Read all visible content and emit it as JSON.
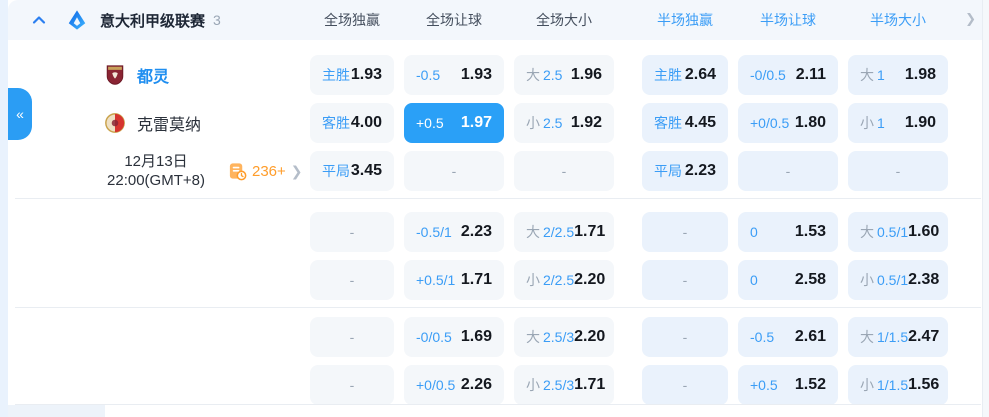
{
  "header": {
    "league_title": "意大利甲级联赛",
    "league_count": "3",
    "columns": [
      "全场独赢",
      "全场让球",
      "全场大小",
      "半场独赢",
      "半场让球",
      "半场大小"
    ],
    "more_arrow": "❯"
  },
  "side_toggle_label": "«",
  "match": {
    "home_team": "都灵",
    "away_team": "克雷莫纳",
    "date_line1": "12月13日",
    "date_line2": "22:00(GMT+8)",
    "markets_count": "236+",
    "markets_arrow": "❯"
  },
  "colors": {
    "accent_blue": "#2aa0f7",
    "label_blue": "#3b9df6",
    "orange": "#ff9d2b",
    "header_half_blue": "#3b9df6"
  },
  "odds": {
    "groups": [
      {
        "rows": [
          [
            {
              "lab": "主胜",
              "odd": "1.93"
            },
            {
              "lab": "-0.5",
              "odd": "1.93"
            },
            {
              "pre": "大",
              "lab": "2.5",
              "odd": "1.96"
            },
            {
              "lab": "主胜",
              "odd": "2.64"
            },
            {
              "lab": "-0/0.5",
              "odd": "2.11"
            },
            {
              "pre": "大",
              "lab": "1",
              "odd": "1.98"
            }
          ],
          [
            {
              "lab": "客胜",
              "odd": "4.00"
            },
            {
              "lab": "+0.5",
              "odd": "1.97",
              "sel": true
            },
            {
              "pre": "小",
              "lab": "2.5",
              "odd": "1.92"
            },
            {
              "lab": "客胜",
              "odd": "4.45"
            },
            {
              "lab": "+0/0.5",
              "odd": "1.80"
            },
            {
              "pre": "小",
              "lab": "1",
              "odd": "1.90"
            }
          ],
          [
            {
              "lab": "平局",
              "odd": "3.45"
            },
            {
              "dash": "-"
            },
            {
              "dash": "-"
            },
            {
              "lab": "平局",
              "odd": "2.23"
            },
            {
              "dash": "-"
            },
            {
              "dash": "-"
            }
          ]
        ]
      },
      {
        "rows": [
          [
            {
              "dash": "-"
            },
            {
              "lab": "-0.5/1",
              "odd": "2.23"
            },
            {
              "pre": "大",
              "lab": "2/2.5",
              "odd": "1.71"
            },
            {
              "dash": "-"
            },
            {
              "lab": "0",
              "odd": "1.53"
            },
            {
              "pre": "大",
              "lab": "0.5/1",
              "odd": "1.60"
            }
          ],
          [
            {
              "dash": "-"
            },
            {
              "lab": "+0.5/1",
              "odd": "1.71"
            },
            {
              "pre": "小",
              "lab": "2/2.5",
              "odd": "2.20"
            },
            {
              "dash": "-"
            },
            {
              "lab": "0",
              "odd": "2.58"
            },
            {
              "pre": "小",
              "lab": "0.5/1",
              "odd": "2.38"
            }
          ]
        ]
      },
      {
        "rows": [
          [
            {
              "dash": "-"
            },
            {
              "lab": "-0/0.5",
              "odd": "1.69"
            },
            {
              "pre": "大",
              "lab": "2.5/3",
              "odd": "2.20"
            },
            {
              "dash": "-"
            },
            {
              "lab": "-0.5",
              "odd": "2.61"
            },
            {
              "pre": "大",
              "lab": "1/1.5",
              "odd": "2.47"
            }
          ],
          [
            {
              "dash": "-"
            },
            {
              "lab": "+0/0.5",
              "odd": "2.26"
            },
            {
              "pre": "小",
              "lab": "2.5/3",
              "odd": "1.71"
            },
            {
              "dash": "-"
            },
            {
              "lab": "+0.5",
              "odd": "1.52"
            },
            {
              "pre": "小",
              "lab": "1/1.5",
              "odd": "1.56"
            }
          ]
        ]
      }
    ]
  }
}
